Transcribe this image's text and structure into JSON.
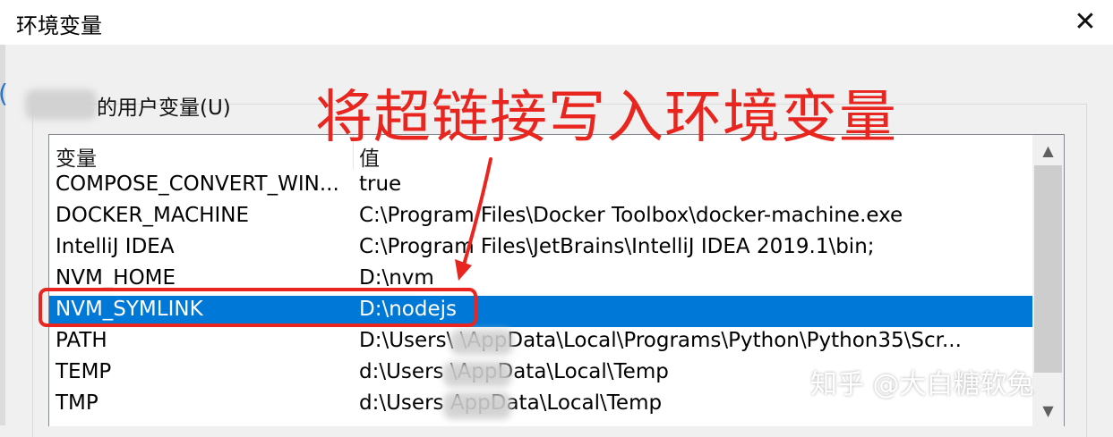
{
  "window": {
    "title": "环境变量",
    "close_glyph": "✕"
  },
  "user_section": {
    "label": "的用户变量(U)"
  },
  "table": {
    "headers": [
      "变量",
      "值"
    ],
    "rows": [
      {
        "name": "COMPOSE_CONVERT_WIN...",
        "value": "true"
      },
      {
        "name": "DOCKER_MACHINE",
        "value": "C:\\Program Files\\Docker Toolbox\\docker-machine.exe"
      },
      {
        "name": "IntelliJ IDEA",
        "value": "C:\\Program Files\\JetBrains\\IntelliJ IDEA 2019.1\\bin;"
      },
      {
        "name": "NVM_HOME",
        "value": "D:\\nvm"
      },
      {
        "name": "NVM_SYMLINK",
        "value": "D:\\nodejs"
      },
      {
        "name": "PATH",
        "value": "D:\\Users\\          \\AppData\\Local\\Programs\\Python\\Python35\\Scr..."
      },
      {
        "name": "TEMP",
        "value": "d:\\Users            \\AppData\\Local\\Temp"
      },
      {
        "name": "TMP",
        "value": "d:\\Users            AppData\\Local\\Temp"
      }
    ],
    "selected_index": 4
  },
  "scrollbar": {
    "up_glyph": "▲",
    "down_glyph": "▼"
  },
  "annotation": {
    "text": "将超链接写入环境变量",
    "color": "#e8261f"
  },
  "watermark": {
    "text": "知乎 @大白糖软兔"
  },
  "colors": {
    "selection": "#0078d7",
    "annotation_red": "#e8261f"
  }
}
